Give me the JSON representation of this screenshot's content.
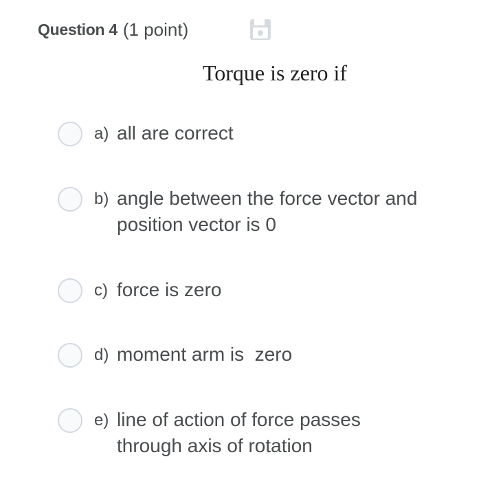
{
  "question": {
    "title": "Question 4",
    "points": "(1 point)",
    "save_icon": "floppy-disk-icon",
    "text": "Torque is zero if"
  },
  "options": [
    {
      "letter": "a)",
      "text": "all are correct"
    },
    {
      "letter": "b)",
      "text": "angle between the force vector and\nposition vector is 0"
    },
    {
      "letter": "c)",
      "text": "force is zero"
    },
    {
      "letter": "d)",
      "text": "moment arm is  zero"
    },
    {
      "letter": "e)",
      "text": "line of action of force passes\nthrough axis of rotation"
    }
  ]
}
